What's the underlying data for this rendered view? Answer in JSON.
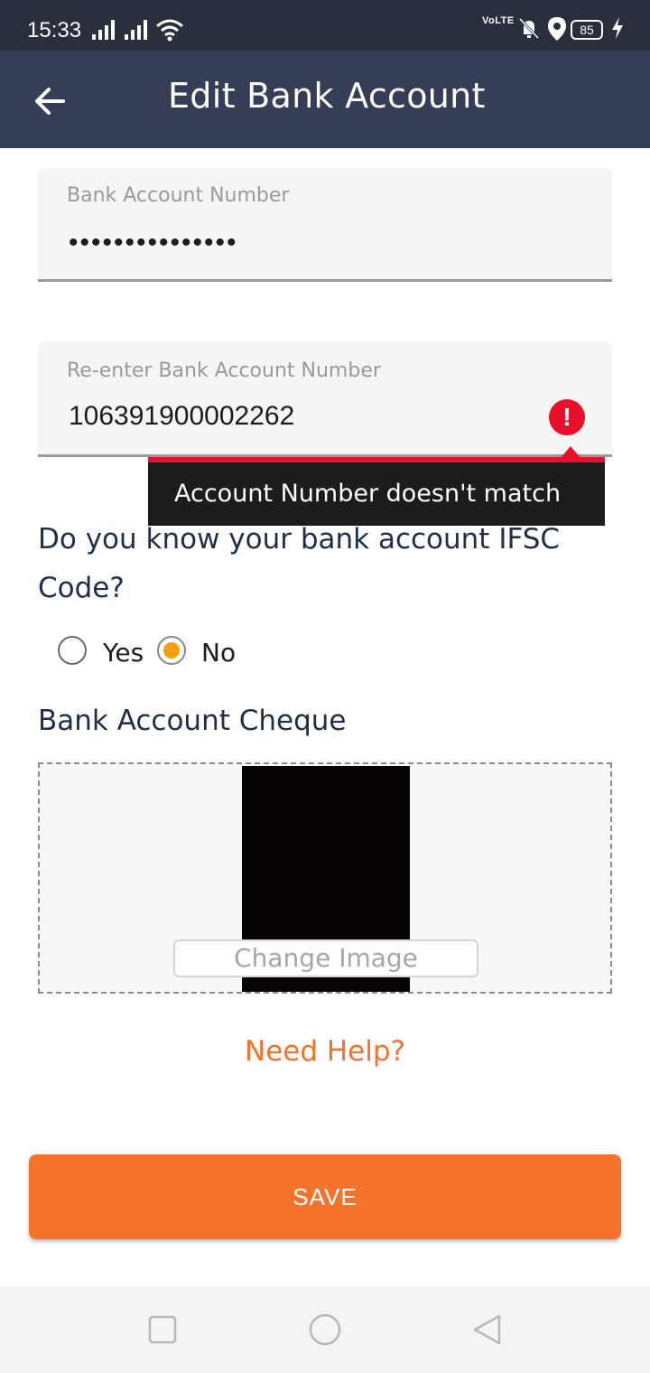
{
  "status_bar": {
    "time": "15:33",
    "network": "VoLTE",
    "battery": "85"
  },
  "app_bar": {
    "title": "Edit Bank Account"
  },
  "form": {
    "account_number": {
      "label": "Bank Account Number",
      "value": "•••••••••••••••"
    },
    "reenter_account_number": {
      "label": "Re-enter Bank Account Number",
      "value": "106391900002262",
      "error_icon": "!",
      "error": "Account Number doesn't match"
    },
    "ifsc_question": "Do you know your bank account IFSC Code?",
    "ifsc_options": [
      {
        "label": "Yes",
        "selected": false
      },
      {
        "label": "No",
        "selected": true
      }
    ],
    "cheque_section_title": "Bank Account Cheque",
    "change_image_label": "Change Image"
  },
  "help_link": "Need Help?",
  "save_button": "SAVE",
  "colors": {
    "status_bar": "#2a2f3d",
    "app_bar": "#363e57",
    "accent_orange": "#f6732c",
    "error_red": "#e8102a",
    "radio_selected": "#f59f12",
    "text_navy": "#1f2f4a"
  },
  "icons": [
    "back-arrow-icon",
    "error-icon",
    "signal-icon",
    "wifi-icon",
    "mute-icon",
    "location-icon",
    "charging-icon",
    "nav-recents-icon",
    "nav-home-icon",
    "nav-back-icon"
  ]
}
